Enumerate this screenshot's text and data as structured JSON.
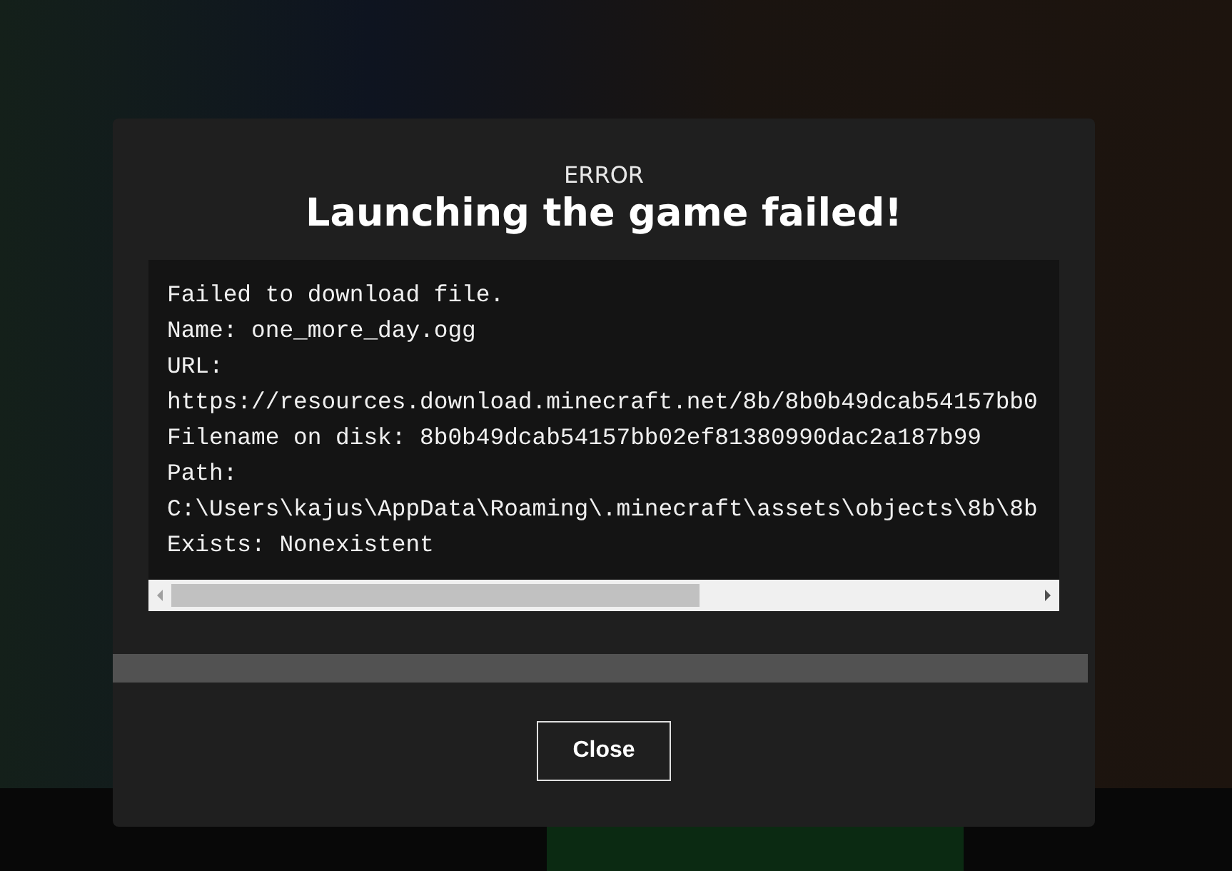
{
  "dialog": {
    "caption": "ERROR",
    "title": "Launching the game failed!",
    "log_lines": [
      "Failed to download file.",
      "Name: one_more_day.ogg",
      "URL:",
      "https://resources.download.minecraft.net/8b/8b0b49dcab54157bb0",
      "Filename on disk: 8b0b49dcab54157bb02ef81380990dac2a187b99",
      "Path:",
      "C:\\Users\\kajus\\AppData\\Roaming\\.minecraft\\assets\\objects\\8b\\8b",
      "Exists: Nonexistent"
    ],
    "buttons": [
      "Close"
    ]
  }
}
